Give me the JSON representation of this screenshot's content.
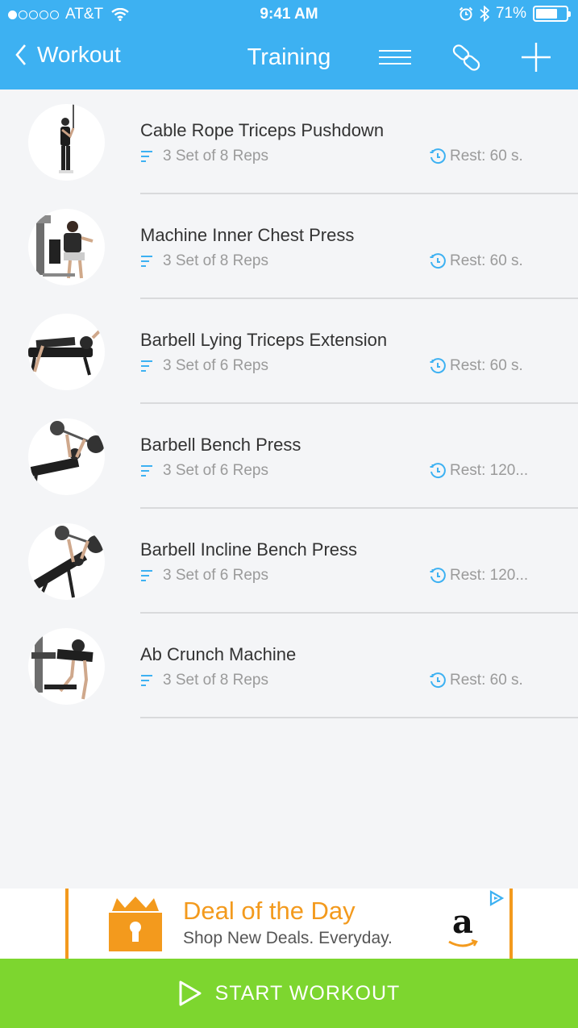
{
  "status_bar": {
    "carrier": "AT&T",
    "time": "9:41 AM",
    "battery": "71%",
    "battery_level": 0.71
  },
  "nav": {
    "back_label": "Workout",
    "title": "Training",
    "icons": [
      "list-icon",
      "link-icon",
      "plus-icon"
    ]
  },
  "exercises": [
    {
      "name": "Cable Rope Triceps Pushdown",
      "sets": "3 Set of 8 Reps",
      "rest": "Rest: 60 s."
    },
    {
      "name": "Machine Inner Chest Press",
      "sets": "3 Set of 8 Reps",
      "rest": "Rest: 60 s."
    },
    {
      "name": "Barbell Lying Triceps Extension",
      "sets": "3 Set of 6 Reps",
      "rest": "Rest: 60 s."
    },
    {
      "name": "Barbell Bench Press",
      "sets": "3 Set of 6 Reps",
      "rest": "Rest: 120..."
    },
    {
      "name": "Barbell Incline Bench Press",
      "sets": "3 Set of 6 Reps",
      "rest": "Rest: 120..."
    },
    {
      "name": "Ab Crunch Machine",
      "sets": "3 Set of 8 Reps",
      "rest": "Rest: 60 s."
    }
  ],
  "ad": {
    "title": "Deal of the Day",
    "subtitle": "Shop New Deals. Everyday.",
    "brand": "a"
  },
  "start_button": {
    "label": "START WORKOUT"
  },
  "colors": {
    "header": "#3db1f2",
    "accent_icon": "#3db1f2",
    "start_button": "#7dd62f",
    "ad_accent": "#f39a1d"
  }
}
